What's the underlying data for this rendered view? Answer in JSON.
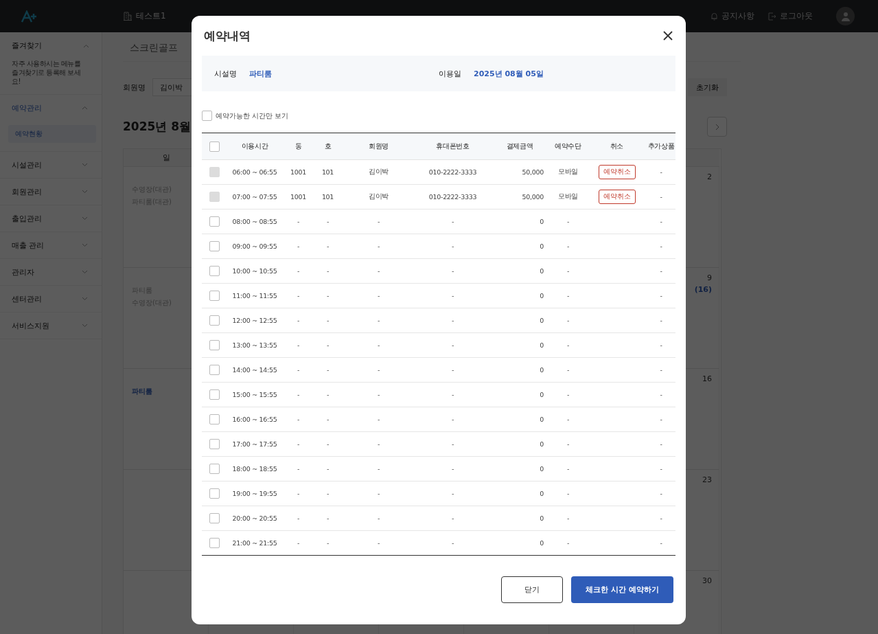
{
  "topbar": {
    "facility": "테스트1",
    "actions": [
      {
        "kind": "bell",
        "label": "공지사항"
      },
      {
        "kind": "logout",
        "label": "로그아웃"
      }
    ]
  },
  "sidebar": {
    "favorites": {
      "label": "즐겨찾기",
      "expanded": true,
      "note": "자주 사용하시는 메뉴를\n즐겨찾기로 등록해 보세요!"
    },
    "items": [
      {
        "label": "예약관리",
        "expanded": true,
        "active": true,
        "children": [
          {
            "label": "예약현황",
            "selected": true
          }
        ]
      },
      {
        "label": "시설관리",
        "expanded": false,
        "active": false
      },
      {
        "label": "회원관리",
        "expanded": false,
        "active": false
      },
      {
        "label": "출입관리",
        "expanded": false,
        "active": false
      },
      {
        "label": "매출 관리",
        "expanded": false,
        "active": false
      },
      {
        "label": "관리자",
        "expanded": false,
        "active": false
      },
      {
        "label": "센터관리",
        "expanded": false,
        "active": false
      },
      {
        "label": "서비스지원",
        "expanded": false,
        "active": false
      }
    ]
  },
  "main": {
    "tabs": [
      {
        "label": "스크린골프",
        "selected": false
      }
    ],
    "filter": {
      "label": "회원명",
      "value": "김이박",
      "reset": "초기화"
    },
    "month": "2025년 8월",
    "calendar": {
      "first_day": "일",
      "weeks": [
        {
          "first": [
            {
              "kind": "muted",
              "text": "수영장(대관)"
            },
            {
              "kind": "muted",
              "text": "파티룸(대관)"
            }
          ],
          "day": "2"
        },
        {
          "first": [
            {
              "kind": "muted",
              "text": "파티룸"
            },
            {
              "kind": "muted",
              "text": "수영장(대관)"
            }
          ],
          "day": "9",
          "count": "(16)"
        },
        {
          "first": [
            {
              "kind": "link",
              "text": "파티룸"
            }
          ],
          "day": "16"
        },
        {
          "day": "23"
        },
        {
          "day": "30"
        }
      ]
    }
  },
  "modal": {
    "title": "예약내역",
    "facility_label": "시설명",
    "facility": "파티룸",
    "date_label": "이용일",
    "date": "2025년 08월 05일",
    "available_only": {
      "label": "예약가능한 시간만 보기",
      "checked": false
    },
    "columns": [
      "이용시간",
      "동",
      "호",
      "회원명",
      "휴대폰번호",
      "결제금액",
      "예약수단",
      "취소",
      "추가상품"
    ],
    "all_checked": false,
    "rows": [
      {
        "time": "06:00 ~ 06:55",
        "dong": "1001",
        "ho": "101",
        "member": "김이박",
        "phone": "010-2222-3333",
        "amount": "50,000",
        "method": "모바일",
        "cancel": "예약취소",
        "extra": "-",
        "checked": false,
        "disabled": true
      },
      {
        "time": "07:00 ~ 07:55",
        "dong": "1001",
        "ho": "101",
        "member": "김이박",
        "phone": "010-2222-3333",
        "amount": "50,000",
        "method": "모바일",
        "cancel": "예약취소",
        "extra": "-",
        "checked": false,
        "disabled": true
      },
      {
        "time": "08:00 ~ 08:55",
        "dong": "-",
        "ho": "-",
        "member": "-",
        "phone": "-",
        "amount": "0",
        "method": "-",
        "extra": "-",
        "checked": false,
        "disabled": false
      },
      {
        "time": "09:00 ~ 09:55",
        "dong": "-",
        "ho": "-",
        "member": "-",
        "phone": "-",
        "amount": "0",
        "method": "-",
        "extra": "-",
        "checked": false,
        "disabled": false
      },
      {
        "time": "10:00 ~ 10:55",
        "dong": "-",
        "ho": "-",
        "member": "-",
        "phone": "-",
        "amount": "0",
        "method": "-",
        "extra": "-",
        "checked": false,
        "disabled": false
      },
      {
        "time": "11:00 ~ 11:55",
        "dong": "-",
        "ho": "-",
        "member": "-",
        "phone": "-",
        "amount": "0",
        "method": "-",
        "extra": "-",
        "checked": false,
        "disabled": false
      },
      {
        "time": "12:00 ~ 12:55",
        "dong": "-",
        "ho": "-",
        "member": "-",
        "phone": "-",
        "amount": "0",
        "method": "-",
        "extra": "-",
        "checked": false,
        "disabled": false
      },
      {
        "time": "13:00 ~ 13:55",
        "dong": "-",
        "ho": "-",
        "member": "-",
        "phone": "-",
        "amount": "0",
        "method": "-",
        "extra": "-",
        "checked": false,
        "disabled": false
      },
      {
        "time": "14:00 ~ 14:55",
        "dong": "-",
        "ho": "-",
        "member": "-",
        "phone": "-",
        "amount": "0",
        "method": "-",
        "extra": "-",
        "checked": false,
        "disabled": false
      },
      {
        "time": "15:00 ~ 15:55",
        "dong": "-",
        "ho": "-",
        "member": "-",
        "phone": "-",
        "amount": "0",
        "method": "-",
        "extra": "-",
        "checked": false,
        "disabled": false
      },
      {
        "time": "16:00 ~ 16:55",
        "dong": "-",
        "ho": "-",
        "member": "-",
        "phone": "-",
        "amount": "0",
        "method": "-",
        "extra": "-",
        "checked": false,
        "disabled": false
      },
      {
        "time": "17:00 ~ 17:55",
        "dong": "-",
        "ho": "-",
        "member": "-",
        "phone": "-",
        "amount": "0",
        "method": "-",
        "extra": "-",
        "checked": false,
        "disabled": false
      },
      {
        "time": "18:00 ~ 18:55",
        "dong": "-",
        "ho": "-",
        "member": "-",
        "phone": "-",
        "amount": "0",
        "method": "-",
        "extra": "-",
        "checked": false,
        "disabled": false
      },
      {
        "time": "19:00 ~ 19:55",
        "dong": "-",
        "ho": "-",
        "member": "-",
        "phone": "-",
        "amount": "0",
        "method": "-",
        "extra": "-",
        "checked": false,
        "disabled": false
      },
      {
        "time": "20:00 ~ 20:55",
        "dong": "-",
        "ho": "-",
        "member": "-",
        "phone": "-",
        "amount": "0",
        "method": "-",
        "extra": "-",
        "checked": false,
        "disabled": false
      },
      {
        "time": "21:00 ~ 21:55",
        "dong": "-",
        "ho": "-",
        "member": "-",
        "phone": "-",
        "amount": "0",
        "method": "-",
        "extra": "-",
        "checked": false,
        "disabled": false
      }
    ],
    "buttons": [
      {
        "kind": "secondary",
        "label": "닫기"
      },
      {
        "kind": "primary",
        "label": "체크한 시간 예약하기"
      }
    ]
  }
}
